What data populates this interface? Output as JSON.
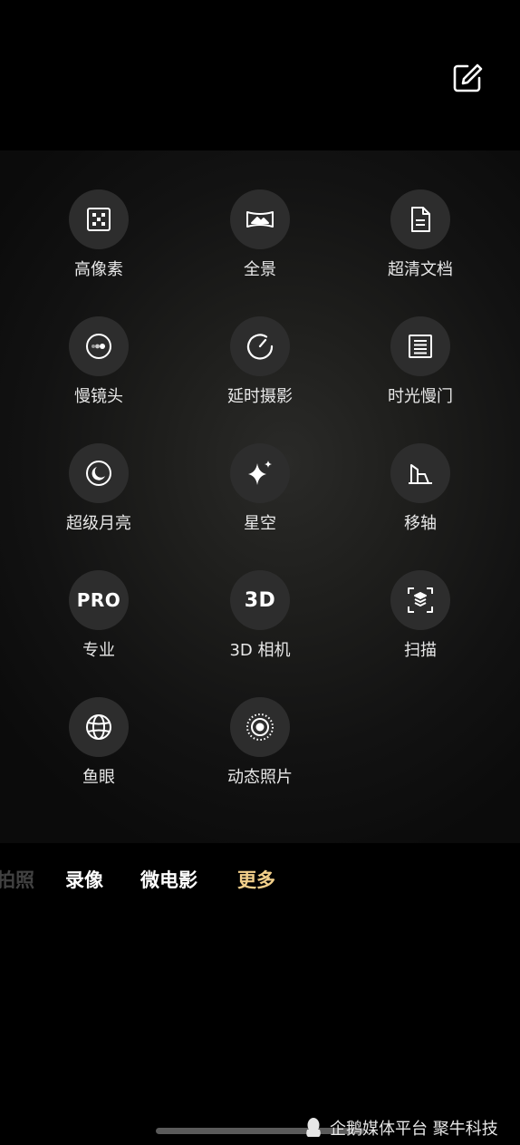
{
  "top_bar": {
    "edit_icon": "edit-icon"
  },
  "modes": [
    {
      "label": "高像素",
      "icon": "high-pixel-icon"
    },
    {
      "label": "全景",
      "icon": "panorama-icon"
    },
    {
      "label": "超清文档",
      "icon": "document-icon"
    },
    {
      "label": "慢镜头",
      "icon": "slow-motion-icon"
    },
    {
      "label": "延时摄影",
      "icon": "timelapse-icon"
    },
    {
      "label": "时光慢门",
      "icon": "long-exposure-icon"
    },
    {
      "label": "超级月亮",
      "icon": "moon-icon"
    },
    {
      "label": "星空",
      "icon": "sparkle-icon"
    },
    {
      "label": "移轴",
      "icon": "tilt-shift-icon"
    },
    {
      "label": "专业",
      "icon_text": "PRO"
    },
    {
      "label": "3D 相机",
      "icon_text": "3D"
    },
    {
      "label": "扫描",
      "icon": "scan-icon"
    },
    {
      "label": "鱼眼",
      "icon": "fisheye-icon"
    },
    {
      "label": "动态照片",
      "icon": "live-photo-icon"
    }
  ],
  "tabs": [
    {
      "label": "拍照",
      "state": "partial"
    },
    {
      "label": "录像",
      "state": "normal"
    },
    {
      "label": "微电影",
      "state": "normal"
    },
    {
      "label": "更多",
      "state": "active"
    }
  ],
  "watermark": {
    "text": "企鹅媒体平台 聚牛科技",
    "icon": "penguin-icon"
  },
  "colors": {
    "active_tab": "#f2cf8a",
    "icon_bg": "#2d2d2d",
    "background": "#000000"
  }
}
